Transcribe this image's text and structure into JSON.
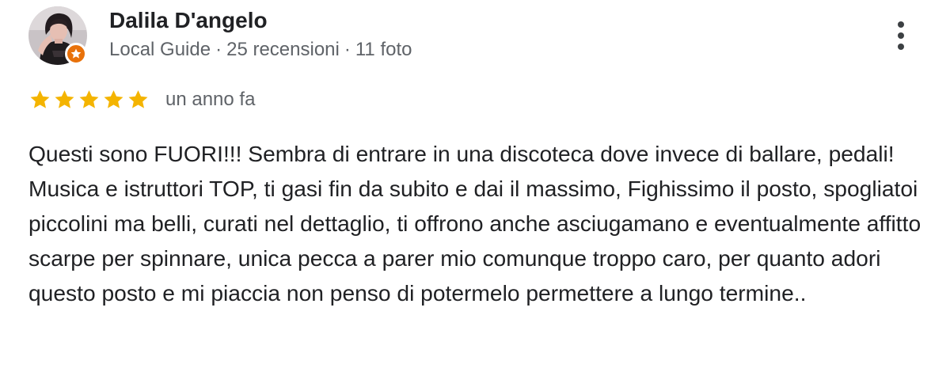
{
  "reviewer": {
    "name": "Dalila D'angelo",
    "badge": "Local Guide",
    "reviews_count": "25 recensioni",
    "photos_count": "11 foto",
    "separator": "·"
  },
  "review": {
    "rating": 5,
    "max_rating": 5,
    "date": "un anno fa",
    "text": "Questi sono FUORI!!! Sembra di entrare in una discoteca dove invece di ballare, pedali! Musica e istruttori TOP, ti gasi fin da subito e dai il massimo, Fighissimo il posto, spogliatoi piccolini ma belli, curati nel dettaglio, ti offrono anche asciugamano e eventualmente affitto scarpe per spinnare, unica pecca a parer mio comunque troppo caro, per quanto adori questo posto e mi piaccia non penso di potermelo permettere a lungo termine.."
  },
  "icons": {
    "menu": "more-vertical-icon",
    "star": "star-icon",
    "badge": "local-guide-star-icon"
  },
  "colors": {
    "star": "#f4b400",
    "badge": "#e8710a",
    "name": "#202124",
    "meta": "#5f6368",
    "body": "#202124"
  }
}
